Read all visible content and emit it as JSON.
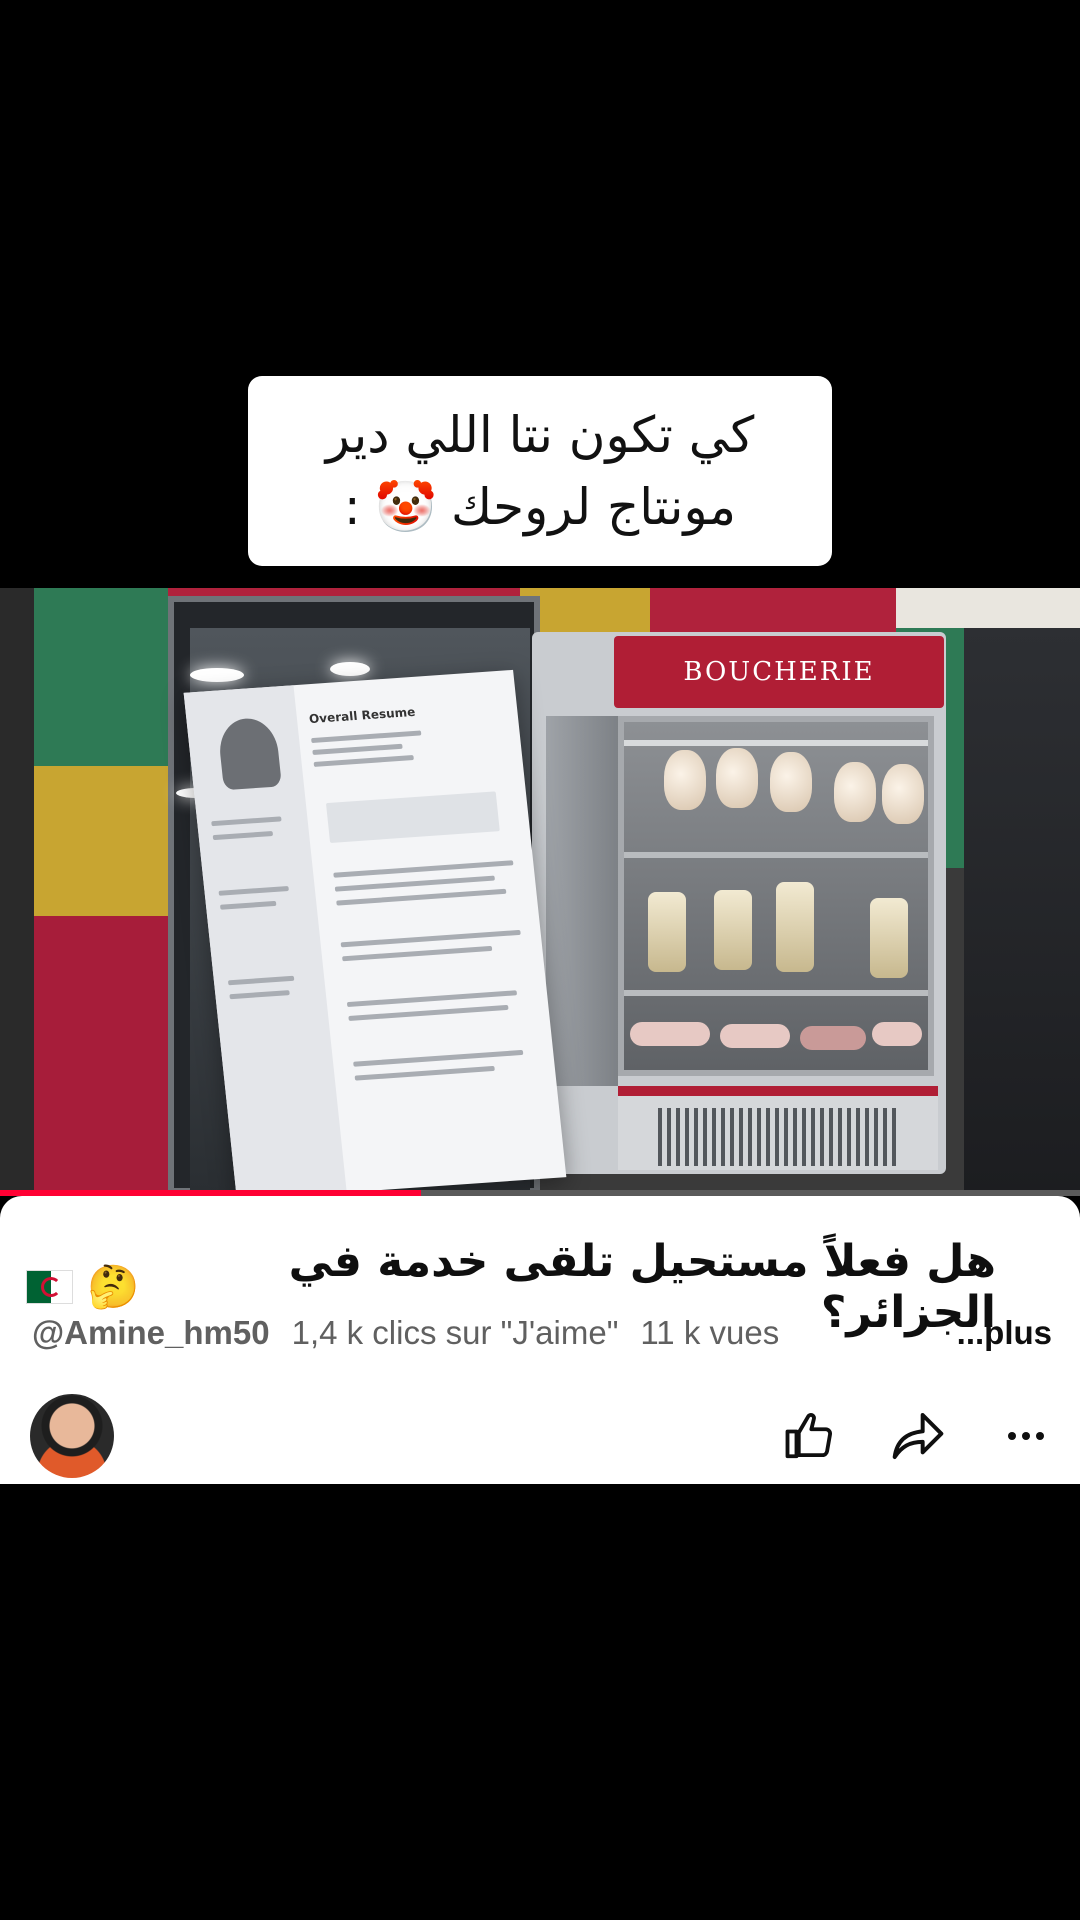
{
  "overlay": {
    "caption_line1": "كي تكون نتا اللي دير",
    "caption_line2": "مونتاج لروحك",
    "caption_emoji": "🤡",
    "caption_colon": ":"
  },
  "video": {
    "shop_sign": "BOUCHERIE",
    "resume_heading": "Overall Resume",
    "progress_fraction": 0.39
  },
  "info": {
    "title": "هل فعلاً مستحيل تلقى خدمة في الجزائر؟",
    "title_emoji": "🤔",
    "flag_icon": "algeria-flag-icon",
    "channel": "@Amine_hm50",
    "likes": "1,4 k clics sur \"J'aime\"",
    "views": "11 k vues",
    "more_label": "...plus"
  },
  "actions": {
    "like_icon": "thumbs-up-icon",
    "share_icon": "share-arrow-icon",
    "more_icon": "more-dots-icon"
  },
  "colors": {
    "progress": "#ff0033",
    "panel_bg": "#ffffff",
    "shop_red": "#b01e35"
  }
}
